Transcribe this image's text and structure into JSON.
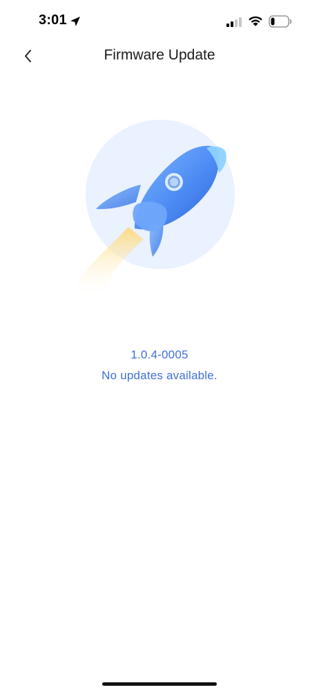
{
  "status_bar": {
    "time": "3:01",
    "location_icon": "location-arrow-icon",
    "signal_icon": "cellular-signal-icon",
    "wifi_icon": "wifi-icon",
    "battery_icon": "battery-icon",
    "battery_level": 0.18
  },
  "nav": {
    "back_icon": "chevron-left-icon",
    "title": "Firmware Update"
  },
  "illustration": {
    "icon": "rocket-icon",
    "colors": {
      "circle": "#eaf1ff",
      "rocket_body": "#4d8cf4",
      "rocket_light": "#7fb7ff",
      "rocket_dark": "#2f63d9",
      "flame": "#ffd66b"
    }
  },
  "firmware": {
    "version": "1.0.4-0005",
    "status": "No updates available."
  },
  "colors": {
    "accent": "#3f6fd8",
    "background": "#ffffff",
    "text": "#1a1a1a"
  }
}
